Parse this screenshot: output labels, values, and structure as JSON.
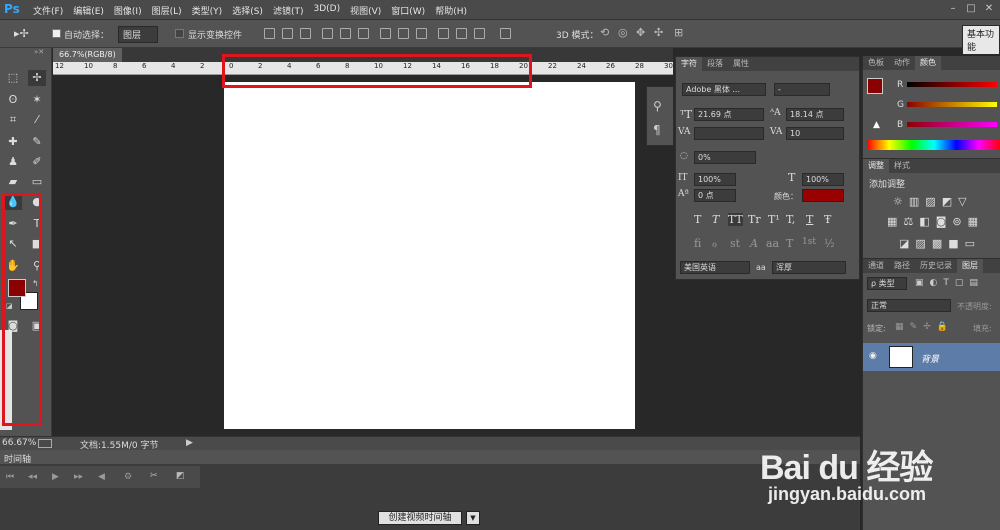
{
  "app": {
    "logo": "Ps"
  },
  "menu": [
    "文件(F)",
    "编辑(E)",
    "图像(I)",
    "图层(L)",
    "类型(Y)",
    "选择(S)",
    "滤镜(T)",
    "3D(D)",
    "视图(V)",
    "窗口(W)",
    "帮助(H)"
  ],
  "options": {
    "auto_select_label": "自动选择：",
    "auto_select_value": "图层",
    "show_transform_label": "显示变换控件",
    "mode_3d_label": "3D 模式：",
    "workspace": "基本功能"
  },
  "document": {
    "tab_label": "66.7%(RGB/8)",
    "ruler_ticks": [
      "12",
      "10",
      "8",
      "6",
      "4",
      "2",
      "0",
      "2",
      "4",
      "6",
      "8",
      "10",
      "12",
      "14",
      "16",
      "18",
      "20",
      "22",
      "24",
      "26",
      "28",
      "30"
    ],
    "zoom": "66.67%",
    "doc_info": "文档:1.55M/0 字节"
  },
  "colors": {
    "foreground": "#8b0000",
    "background": "#ffffff",
    "highlight": "#e0141c"
  },
  "timeline": {
    "title": "时间轴",
    "create_button": "创建视频时间轴"
  },
  "character": {
    "tabs": [
      "字符",
      "段落",
      "属性"
    ],
    "font_family": "Adobe 黑体 ...",
    "font_style": "-",
    "font_size": "21.69 点",
    "leading": "18.14 点",
    "kerning": "",
    "tracking": "10",
    "scale_percent": "0%",
    "vertical_scale": "100%",
    "horizontal_scale": "100%",
    "baseline_shift": "0 点",
    "color_label": "颜色：",
    "color_value": "#990000",
    "style_buttons": [
      "T",
      "T",
      "TT",
      "Tr",
      "T¹",
      "T,",
      "T",
      "Ŧ"
    ],
    "opentype_buttons": [
      "fi",
      "ℴ",
      "st",
      "A",
      "aa",
      "T",
      "1st",
      "½"
    ],
    "language": "美国英语",
    "aa_label": "aa",
    "antialias": "浑厚"
  },
  "color_panel": {
    "tabs": [
      "色板",
      "动作",
      "颜色"
    ],
    "channels": [
      "R",
      "G",
      "B"
    ]
  },
  "adjust_panel": {
    "tabs": [
      "调整",
      "样式"
    ],
    "title": "添加调整"
  },
  "layers_panel": {
    "tabs": [
      "通道",
      "路径",
      "历史记录",
      "图层"
    ],
    "filter_label": "ρ 类型",
    "blend_mode": "正常",
    "opacity_label": "不透明度:",
    "lock_label": "锁定:",
    "fill_label": "填充:",
    "layers": [
      {
        "name": "背景"
      }
    ]
  },
  "watermark": {
    "brand": "Bai du 经验",
    "url": "jingyan.baidu.com"
  }
}
